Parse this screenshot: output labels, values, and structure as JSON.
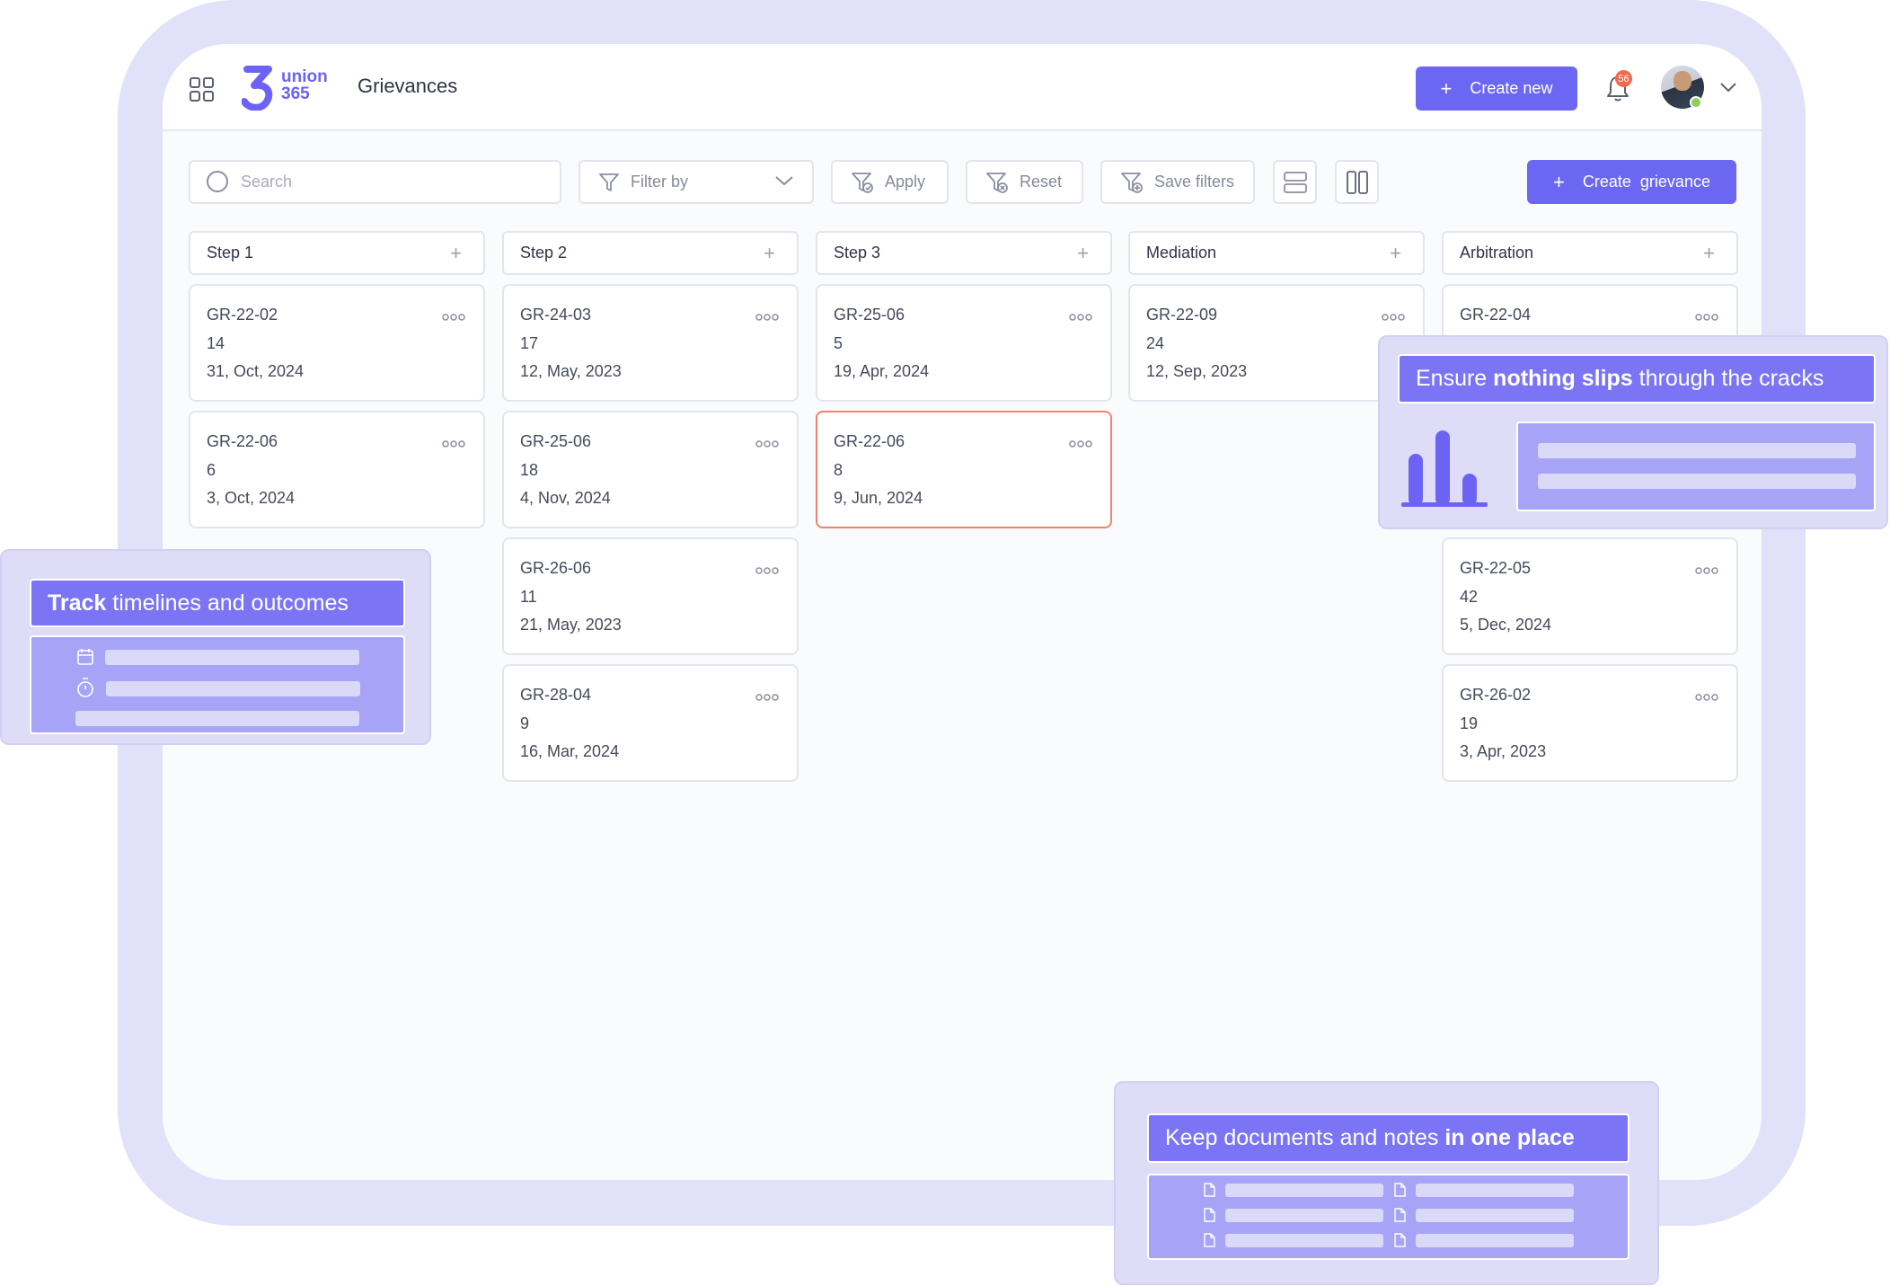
{
  "app": {
    "logo_text_line1": "union",
    "logo_text_line2": "365",
    "page_title": "Grievances",
    "create_new_label": "Create new",
    "notifications_count": "56"
  },
  "toolbar": {
    "search_placeholder": "Search",
    "filter_label": "Filter by",
    "apply_label": "Apply",
    "reset_label": "Reset",
    "save_filters_label": "Save filters",
    "create_grievance_label": "Create  grievance"
  },
  "columns": [
    {
      "title": "Step 1",
      "cards": [
        {
          "id": "GR-22-02",
          "count": "14",
          "date": "31, Oct, 2024"
        },
        {
          "id": "GR-22-06",
          "count": "6",
          "date": "3, Oct, 2024"
        }
      ]
    },
    {
      "title": "Step 2",
      "cards": [
        {
          "id": "GR-24-03",
          "count": "17",
          "date": "12, May, 2023"
        },
        {
          "id": "GR-25-06",
          "count": "18",
          "date": "4, Nov, 2024"
        },
        {
          "id": "GR-26-06",
          "count": "11",
          "date": "21, May, 2023"
        },
        {
          "id": "GR-28-04",
          "count": "9",
          "date": "16, Mar, 2024"
        }
      ]
    },
    {
      "title": "Step 3",
      "cards": [
        {
          "id": "GR-25-06",
          "count": "5",
          "date": "19, Apr, 2024"
        },
        {
          "id": "GR-22-06",
          "count": "8",
          "date": "9, Jun, 2024"
        }
      ]
    },
    {
      "title": "Mediation",
      "cards": [
        {
          "id": "GR-22-09",
          "count": "24",
          "date": "12, Sep, 2023"
        }
      ]
    },
    {
      "title": "Arbitration",
      "cards": [
        {
          "id": "GR-22-04"
        },
        {
          "id": "GR-22-05",
          "count": "42",
          "date": "5, Dec, 2024"
        },
        {
          "id": "GR-26-02",
          "count": "19",
          "date": "3, Apr, 2023"
        }
      ]
    }
  ],
  "callouts": {
    "track": {
      "bold": "Track",
      "rest": " timelines and outcomes"
    },
    "ensure": {
      "pre": "Ensure ",
      "bold": "nothing slips",
      "post": " through the cracks"
    },
    "keep": {
      "pre": "Keep documents and notes ",
      "bold": "in one place"
    }
  },
  "colors": {
    "accent": "#6c67f2",
    "highlight_border": "#f0826e",
    "badge": "#f26a4f",
    "frame": "#e2e1fa"
  }
}
